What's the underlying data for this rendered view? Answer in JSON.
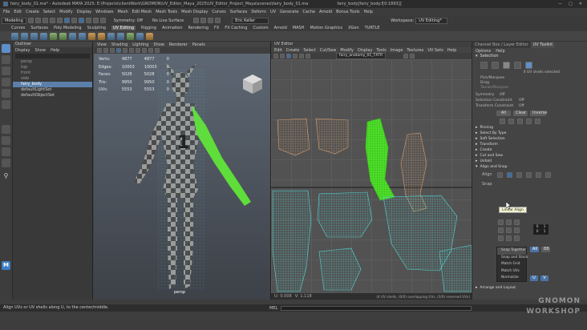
{
  "window": {
    "title": "fairy_body_01.ma* - Autodesk MAYA 2025: E:\\Projects\\clientWork\\GNOMON\\UV_Editor_Maya_2025\\UV_Editor_Project_Maya\\scenes\\fairy_body_01.ma",
    "second_title": "fairy_body[fairy_body.f[0:1893]]"
  },
  "menubar": [
    "File",
    "Edit",
    "Create",
    "Select",
    "Modify",
    "Display",
    "Windows",
    "Mesh",
    "Edit Mesh",
    "Mesh Tools",
    "Mesh Display",
    "Curves",
    "Surfaces",
    "Deform",
    "UV",
    "Generate",
    "Cache",
    "Arnold",
    "Bonus Tools",
    "Help"
  ],
  "status": {
    "mode": "Modeling",
    "symmetry": "Symmetry: Off",
    "surface": "No Live Surface",
    "user": "Eric Keller",
    "workspace_label": "Workspace:",
    "workspace": "UV Editing*"
  },
  "shelf_tabs": [
    "Curves",
    "Surfaces",
    "Poly Modeling",
    "Sculpting",
    "UV Editing",
    "Rigging",
    "Animation",
    "Rendering",
    "FX",
    "FX Caching",
    "Custom",
    "Arnold",
    "MASH",
    "Motion Graphics",
    "XGen",
    "TURTLE"
  ],
  "shelf_selected": "UV Editing",
  "outliner": {
    "title": "Outliner",
    "menu": [
      "Display",
      "Show",
      "Help"
    ],
    "items": [
      "persp",
      "top",
      "front",
      "side",
      "fairy_body",
      "defaultLightSet",
      "defaultObjectSet"
    ],
    "selected": "fairy_body"
  },
  "viewport": {
    "menu": [
      "View",
      "Shading",
      "Lighting",
      "Show",
      "Renderer",
      "Panels"
    ],
    "hud": [
      [
        "Verts:",
        "4877",
        "4877",
        "0"
      ],
      [
        "Edges:",
        "10003",
        "10003",
        "0"
      ],
      [
        "Faces:",
        "5028",
        "5028",
        "0"
      ],
      [
        "Tris:",
        "9950",
        "9950",
        "0"
      ],
      [
        "UVs:",
        "5553",
        "5553",
        "0"
      ]
    ],
    "camera": "persp"
  },
  "uv_editor": {
    "title": "UV Editor",
    "menu": [
      "Edit",
      "Create",
      "Select",
      "Cut/Sew",
      "Modify",
      "Display",
      "Tools",
      "Image",
      "Textures",
      "UV Sets",
      "Help"
    ],
    "texture": "fairy_anatomy_01_TXTR",
    "status": "(4 UV shells, (0/0) overlapping UVs, (0/0) reversed UVs)",
    "u_label": "U:",
    "u": "0.008",
    "v_label": "V:",
    "v": "1.118"
  },
  "toolkit": {
    "tabs": [
      "Channel Box / Layer Editor",
      "UV Toolkit"
    ],
    "sub_tabs": [
      "Options",
      "Help"
    ],
    "selection_section": "Selection",
    "shells_selected": "4 UV shells selected",
    "pick_options": [
      "Pick/Marquee",
      "Drag",
      "Tweak/Marquee"
    ],
    "symmetry_label": "Symmetry",
    "symmetry_value": "Off",
    "selection_constraint_label": "Selection Constraint",
    "selection_constraint_value": "Off",
    "transform_constraint_label": "Transform Constraint",
    "transform_constraint_value": "Off",
    "select_buttons": [
      "All",
      "Clear",
      "Inverse"
    ],
    "sections": [
      "Pinning",
      "Select By Type",
      "Soft Selection",
      "Transform",
      "Create",
      "Cut and Sew",
      "Unfold",
      "Align and Snap"
    ],
    "align_label": "Align",
    "snap_label": "Snap",
    "snap_values": [
      "0",
      "1",
      "0",
      "1"
    ],
    "snap_buttons": [
      "All",
      "BB"
    ],
    "tooltip": "Linear Align",
    "bottom_section": "Arrange and Layout",
    "bottom_buttons": [
      "U",
      "V"
    ]
  },
  "flyout": [
    "Snap Together",
    "Snap and Stack",
    "Match Grid",
    "Match UVs",
    "Normalize"
  ],
  "helpline": "Align UVs or UV shells along U, to the center/middle.",
  "mel_label": "MEL",
  "watermark": {
    "brand": "GNOMON",
    "sub": "WORKSHOP"
  }
}
